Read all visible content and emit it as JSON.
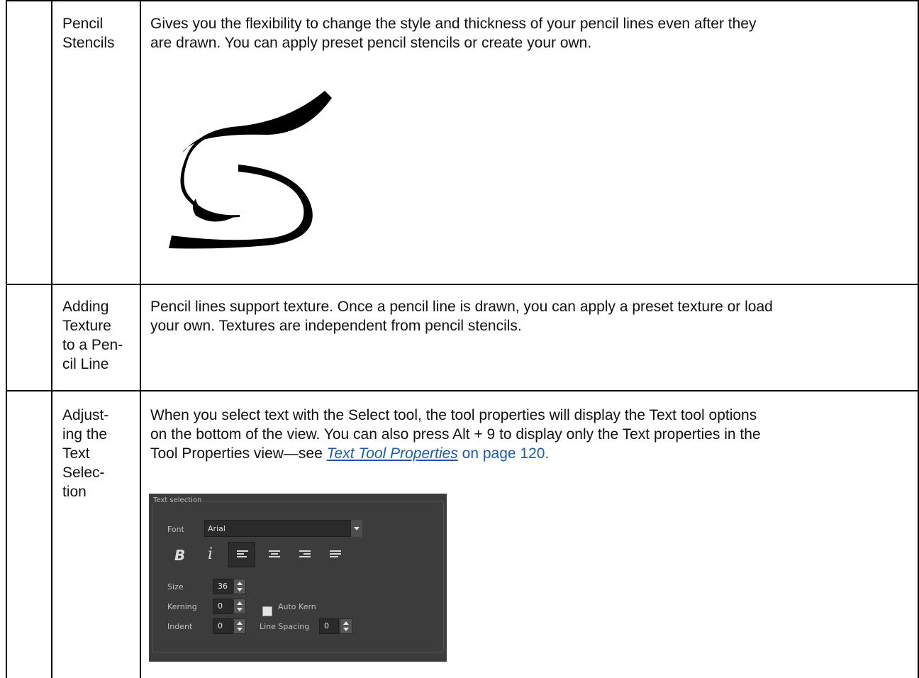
{
  "rows": [
    {
      "label": "Pencil Stencils",
      "label_lines": [
        "Pencil",
        "Stencils"
      ],
      "description": "Gives you the flexibility to change the style and thickness of your pencil lines even after they are drawn. You can apply preset pencil stencils or create your own.",
      "desc_lines": [
        "Gives you the flexibility to change the style and thickness of your pencil lines even after they",
        "are drawn. You can apply preset pencil stencils or create your own."
      ]
    },
    {
      "label": "Adding Texture to a Pencil Line",
      "label_lines": [
        "Adding",
        "Texture",
        "to a Pen-",
        "cil Line"
      ],
      "description": "Pencil lines support texture. Once a pencil line is drawn, you can apply a preset texture or load your own. Textures are independent from pencil stencils.",
      "desc_lines": [
        "Pencil lines support texture. Once a pencil line is drawn, you can apply a preset texture or load",
        "your own. Textures are independent from pencil stencils."
      ]
    },
    {
      "label": "Adjusting the Text Selection",
      "label_lines": [
        "Adjust-",
        "ing the",
        "Text",
        "Selec-",
        "tion"
      ],
      "desc_lines": [
        "When you select text with the Select tool, the tool properties will display the Text tool options",
        "on the bottom of the view. You can also press Alt + 9 to display only the Text properties in the"
      ],
      "desc_line3_prefix": "Tool Properties view—see ",
      "link_text": "Text Tool Properties",
      "desc_line3_suffix": " on page 120."
    }
  ],
  "text_selection_panel": {
    "title": "Text selection",
    "font_label": "Font",
    "font_value": "Arial",
    "bold_glyph": "B",
    "italic_glyph": "i",
    "size_label": "Size",
    "size_value": "36",
    "kerning_label": "Kerning",
    "kerning_value": "0",
    "auto_kern_label": "Auto Kern",
    "indent_label": "Indent",
    "indent_value": "0",
    "line_spacing_label": "Line Spacing",
    "line_spacing_value": "0"
  }
}
